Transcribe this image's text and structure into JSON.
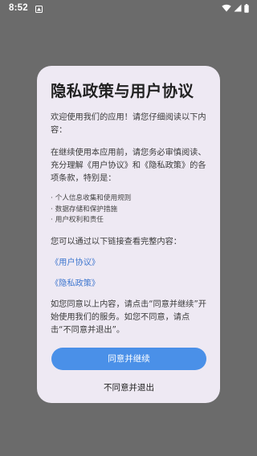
{
  "status_bar": {
    "time": "8:52",
    "icons": [
      "notification-icon",
      "wifi-icon",
      "signal-icon",
      "battery-icon"
    ]
  },
  "dialog": {
    "title": "隐私政策与用户协议",
    "intro": "欢迎使用我们的应用！请您仔细阅读以下内容：",
    "intro2": "在继续使用本应用前，请您务必审慎阅读、充分理解《用户协议》和《隐私政策》的各项条款，特别是：",
    "bullets": [
      {
        "dot": "·",
        "text": "个人信息收集和使用规则"
      },
      {
        "dot": "·",
        "text": "数据存储和保护措施"
      },
      {
        "dot": "·",
        "text": "用户权利和责任"
      }
    ],
    "link_hint": "您可以通过以下链接查看完整内容：",
    "links": {
      "user_agreement": "《用户协议》",
      "privacy_policy": "《隐私政策》"
    },
    "consent_text": "如您同意以上内容，请点击“同意并继续”开始使用我们的服务。如您不同意，请点击“不同意并退出”。",
    "agree_label": "同意并继续",
    "disagree_label": "不同意并退出"
  },
  "colors": {
    "backdrop": "#6b6b6b",
    "dialog_bg": "#eee9f3",
    "link": "#3f77cf",
    "primary_button": "#4a90e8"
  }
}
